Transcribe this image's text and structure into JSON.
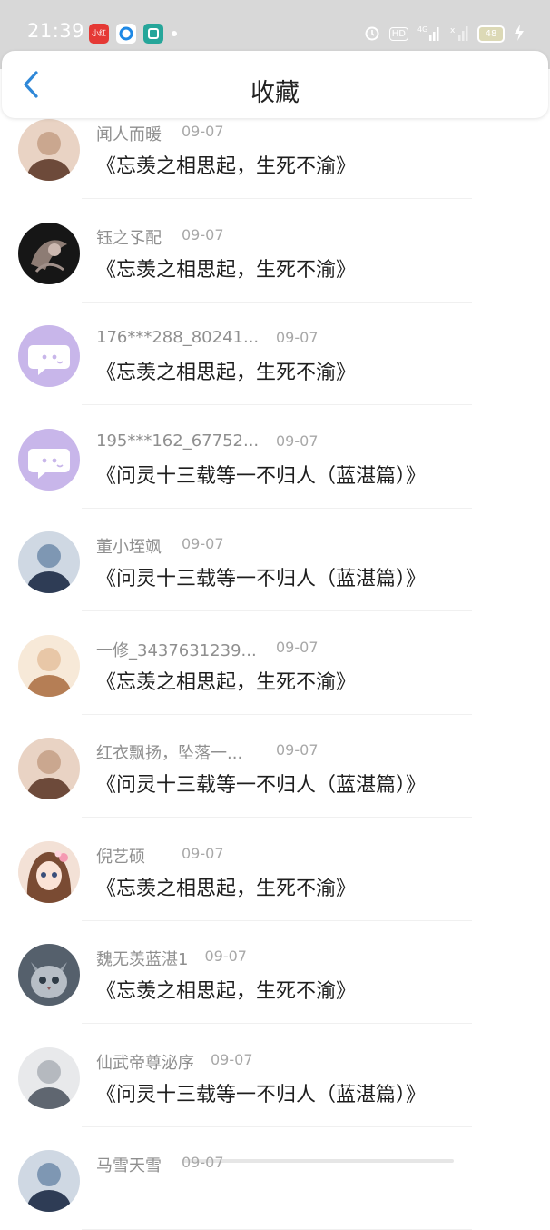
{
  "status_bar": {
    "time": "21:39",
    "battery": "48",
    "network": "4G",
    "hd": "HD",
    "app_icons": [
      {
        "name": "app-icon-red",
        "label": "小红书",
        "color": "#e53935"
      },
      {
        "name": "app-icon-blue",
        "label": "",
        "color": "#1e88e5"
      },
      {
        "name": "app-icon-green",
        "label": "",
        "color": "#26a69a"
      }
    ]
  },
  "header": {
    "title": "收藏",
    "back_icon": "chevron-left-icon",
    "accent_color": "#2f88d8"
  },
  "items": [
    {
      "author": "闻人而暖",
      "date": "09-07",
      "title": "《忘羡之相思起，生死不渝》",
      "avatar": "photo-avatar"
    },
    {
      "author": "钰之孓配",
      "date": "09-07",
      "title": "《忘羡之相思起，生死不渝》",
      "avatar": "illustration-avatar"
    },
    {
      "author": "176***288_80241...",
      "date": "09-07",
      "title": "《忘羡之相思起，生死不渝》",
      "avatar": "default-chat-avatar"
    },
    {
      "author": "195***162_67752...",
      "date": "09-07",
      "title": "《问灵十三载等一不归人（蓝湛篇）》",
      "avatar": "default-chat-avatar"
    },
    {
      "author": "董小垤飒",
      "date": "09-07",
      "title": "《问灵十三载等一不归人（蓝湛篇）》",
      "avatar": "photo-avatar"
    },
    {
      "author": "一修_3437631239...",
      "date": "09-07",
      "title": "《忘羡之相思起，生死不渝》",
      "avatar": "photo-avatar"
    },
    {
      "author": "红衣飘扬，坠落一...",
      "date": "09-07",
      "title": "《问灵十三载等一不归人（蓝湛篇）》",
      "avatar": "photo-avatar"
    },
    {
      "author": "倪艺硕",
      "date": "09-07",
      "title": "《忘羡之相思起，生死不渝》",
      "avatar": "anime-avatar"
    },
    {
      "author": "魏无羡蓝湛1",
      "date": "09-07",
      "title": "《忘羡之相思起，生死不渝》",
      "avatar": "cat-avatar"
    },
    {
      "author": "仙武帝尊泌序",
      "date": "09-07",
      "title": "《问灵十三载等一不归人（蓝湛篇）》",
      "avatar": "photo-avatar"
    },
    {
      "author": "马雪天雪",
      "date": "09-07",
      "title": "",
      "avatar": "photo-avatar"
    }
  ]
}
